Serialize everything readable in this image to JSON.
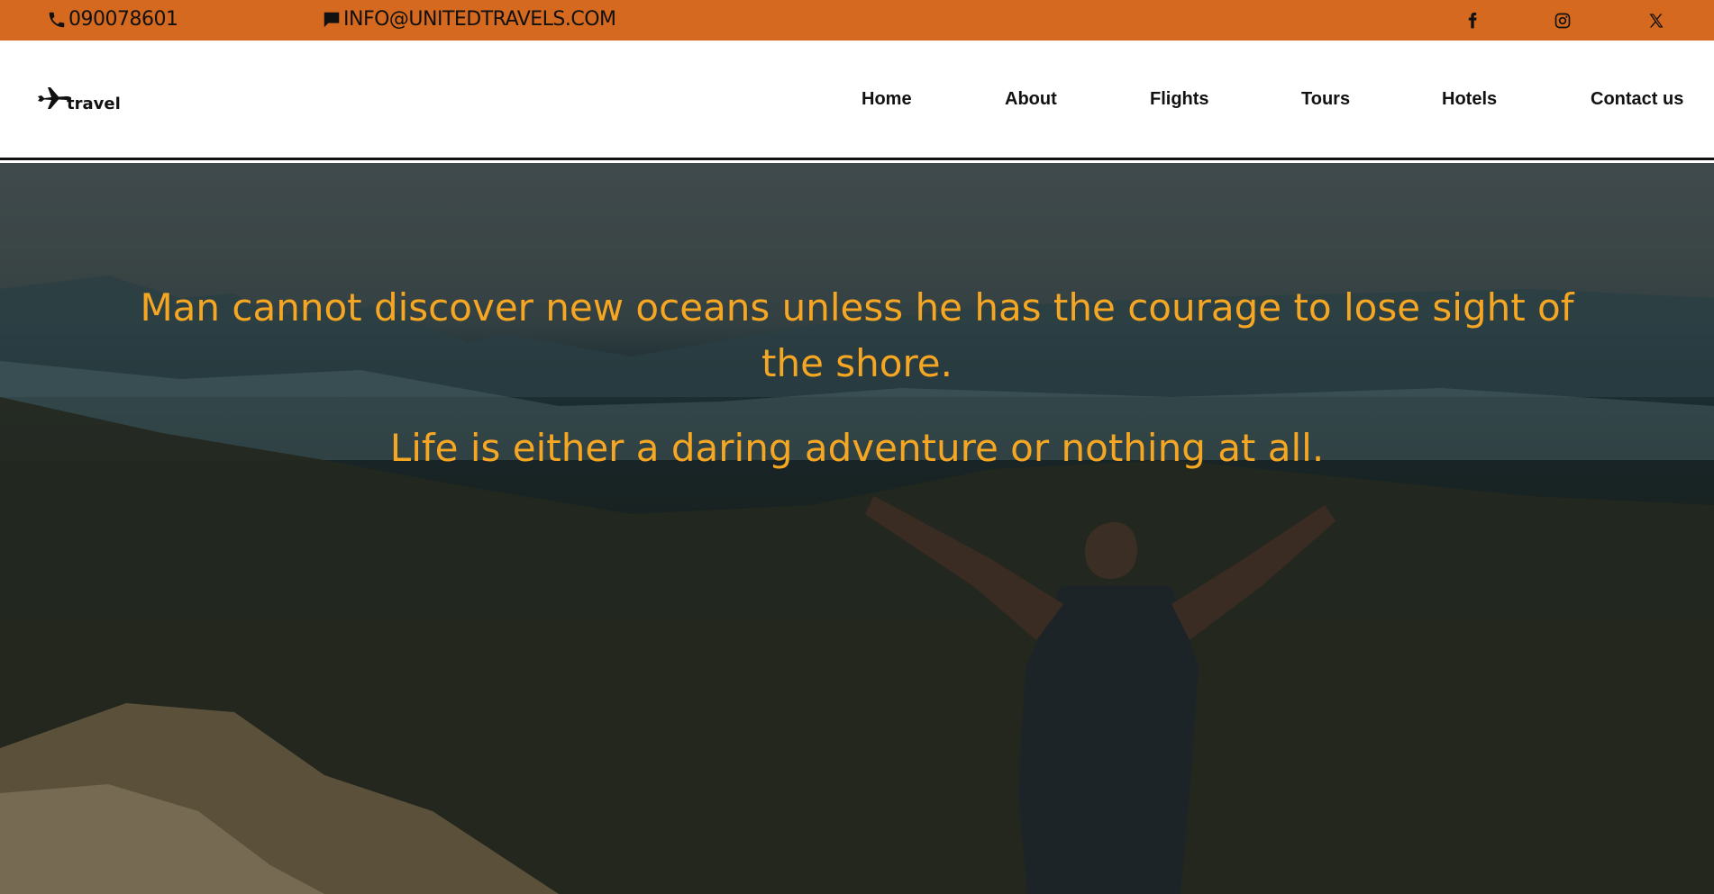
{
  "topbar": {
    "phone": "090078601",
    "email": "info@unitedtravels.com",
    "social": [
      {
        "icon": "facebook-icon"
      },
      {
        "icon": "instagram-icon"
      },
      {
        "icon": "x-icon"
      }
    ]
  },
  "header": {
    "logo_text": "travel",
    "nav": [
      "Home",
      "About",
      "Flights",
      "Tours",
      "Hotels",
      "Contact us"
    ]
  },
  "hero": {
    "quote_1": "Man cannot discover new oceans unless he has the courage to lose sight of the shore.",
    "quote_2": "Life is either a daring adventure or nothing at all."
  },
  "colors": {
    "topbar_bg": "#d4691f",
    "quote_text": "#f5a623",
    "nav_text": "#111111"
  }
}
